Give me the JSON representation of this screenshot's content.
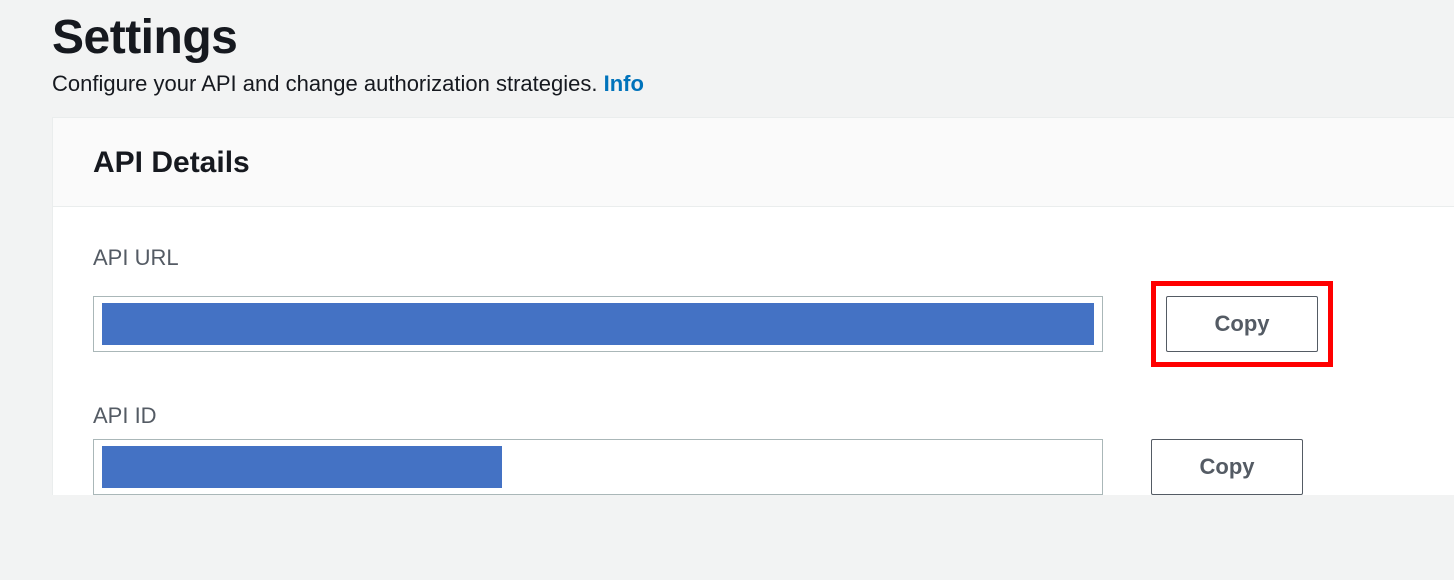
{
  "header": {
    "title": "Settings",
    "subtitle": "Configure your API and change authorization strategies.",
    "info_label": "Info"
  },
  "panel": {
    "title": "API Details",
    "fields": [
      {
        "label": "API URL",
        "value": "",
        "redaction": "full",
        "copy_label": "Copy",
        "highlighted": true
      },
      {
        "label": "API ID",
        "value": "",
        "redaction": "partial",
        "copy_label": "Copy",
        "highlighted": false
      }
    ]
  },
  "colors": {
    "link": "#0073bb",
    "redaction": "#4472c4",
    "highlight": "#ff0000",
    "text": "#16191f",
    "muted": "#545b64"
  }
}
